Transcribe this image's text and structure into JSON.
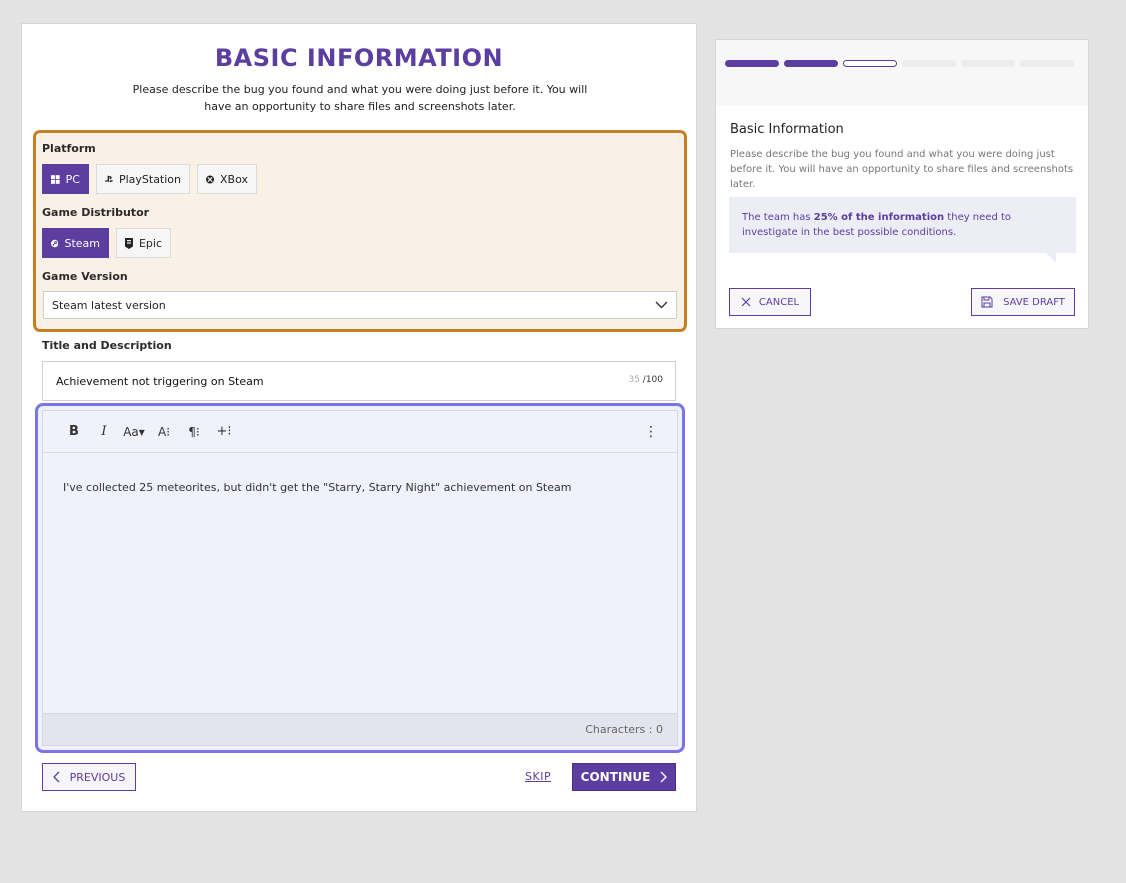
{
  "form": {
    "title": "BASIC INFORMATION",
    "subtitle": "Please describe the bug you found and what you were doing just before it. You will have an opportunity to share files and screenshots later.",
    "platform": {
      "label": "Platform",
      "options": [
        "PC",
        "PlayStation",
        "XBox"
      ],
      "selected": "PC"
    },
    "distributor": {
      "label": "Game Distributor",
      "options": [
        "Steam",
        "Epic"
      ],
      "selected": "Steam"
    },
    "version": {
      "label": "Game Version",
      "value": "Steam latest version"
    },
    "title_description": {
      "label": "Title and Description",
      "title_value": "Achievement not triggering on Steam",
      "title_count": "35",
      "title_max": "/100",
      "description": "I've collected 25 meteorites, but didn't get the \"Starry, Starry Night\" achievement on Steam",
      "char_count_label": "Characters : 0"
    },
    "toolbar": {
      "bold": "B",
      "italic": "I",
      "font_size": "Aa▾",
      "text_style": "A⁝",
      "paragraph": "¶⁝",
      "insert": "+⁝",
      "more": "⋮"
    },
    "nav": {
      "previous": "PREVIOUS",
      "skip": "SKIP",
      "continue": "CONTINUE"
    }
  },
  "side": {
    "progress": {
      "total_steps": 6,
      "completed": 2,
      "current": 3
    },
    "title": "Basic Information",
    "description": "Please describe the bug you found and what you were doing just before it. You will have an opportunity to share files and screenshots later.",
    "info_prefix": "The team has ",
    "info_bold": "25% of the information",
    "info_suffix": " they need to investigate in the best possible conditions.",
    "cancel": "CANCEL",
    "save_draft": "SAVE DRAFT"
  },
  "colors": {
    "accent": "#5b3ea0",
    "meta_border": "#c57e24",
    "meta_bg": "#f9f0e6",
    "editor_border": "#7b74e8"
  }
}
